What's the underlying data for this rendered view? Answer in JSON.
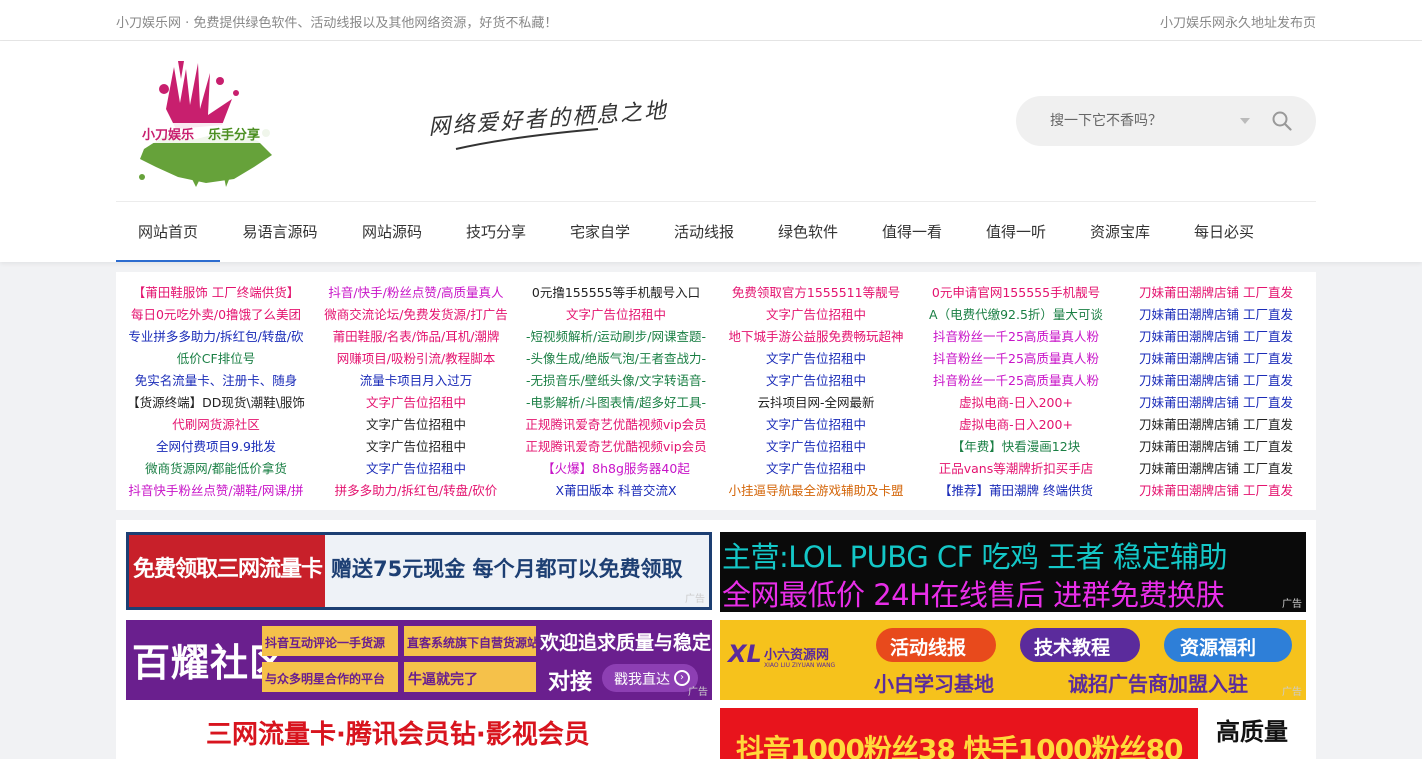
{
  "topbar": {
    "left_text": "小刀娱乐网 · 免费提供绿色软件、活动线报以及其他网络资源，好货不私藏！",
    "right_text": "小刀娱乐网永久地址发布页"
  },
  "logo": {
    "text_left": "小刀娱乐",
    "text_right": "乐手分享"
  },
  "slogan": "网络爱好者的栖息之地",
  "search": {
    "placeholder": "搜一下它不香吗？"
  },
  "nav": {
    "items": [
      {
        "label": "网站首页",
        "active": true
      },
      {
        "label": "易语言源码"
      },
      {
        "label": "网站源码"
      },
      {
        "label": "技巧分享"
      },
      {
        "label": "宅家自学"
      },
      {
        "label": "活动线报"
      },
      {
        "label": "绿色软件"
      },
      {
        "label": "值得一看"
      },
      {
        "label": "值得一听"
      },
      {
        "label": "资源宝库"
      },
      {
        "label": "每日必买"
      }
    ]
  },
  "text_ads": {
    "columns": [
      [
        {
          "text": "【莆田鞋服饰 工厂终端供货】",
          "color": "#e4136f"
        },
        {
          "text": "每日0元吃外卖/0撸饿了么美团",
          "color": "#e4136f"
        },
        {
          "text": "专业拼多多助力/拆红包/转盘/砍",
          "color": "#1a2bb8"
        },
        {
          "text": "低价CF排位号",
          "color": "#1a7f44"
        },
        {
          "text": "免实名流量卡、注册卡、随身",
          "color": "#1a2bb8"
        },
        {
          "text": "【货源终端】DD现货\\潮鞋\\服饰",
          "color": "#222222"
        },
        {
          "text": "代刷网货源社区",
          "color": "#e4136f"
        },
        {
          "text": "全网付费项目9.9批发",
          "color": "#1a2bb8"
        },
        {
          "text": "微商货源网/都能低价拿货",
          "color": "#1a7f44"
        },
        {
          "text": "抖音快手粉丝点赞/潮鞋/网课/拼",
          "color": "#c814c8"
        }
      ],
      [
        {
          "text": "抖音/快手/粉丝点赞/高质量真人",
          "color": "#c814c8"
        },
        {
          "text": "微商交流论坛/免费发货源/打广告",
          "color": "#e4136f"
        },
        {
          "text": "莆田鞋服/名表/饰品/耳机/潮牌",
          "color": "#e4136f"
        },
        {
          "text": "网赚项目/吸粉引流/教程脚本",
          "color": "#e4136f"
        },
        {
          "text": "流量卡项目月入过万",
          "color": "#1a2bb8"
        },
        {
          "text": "文字广告位招租中",
          "color": "#e4136f"
        },
        {
          "text": "文字广告位招租中",
          "color": "#222222"
        },
        {
          "text": "文字广告位招租中",
          "color": "#222222"
        },
        {
          "text": "文字广告位招租中",
          "color": "#1a2bb8"
        },
        {
          "text": "拼多多助力/拆红包/转盘/砍价",
          "color": "#e4136f"
        }
      ],
      [
        {
          "text": "0元撸155555等手机靓号入口",
          "color": "#222222"
        },
        {
          "text": "文字广告位招租中",
          "color": "#e4136f"
        },
        {
          "text": "-短视频解析/运动刷步/网课查题-",
          "color": "#1a7f44"
        },
        {
          "text": "-头像生成/绝版气泡/王者查战力-",
          "color": "#1a7f44"
        },
        {
          "text": "-无损音乐/壁纸头像/文字转语音-",
          "color": "#1a7f44"
        },
        {
          "text": "-电影解析/斗图表情/超多好工具-",
          "color": "#1a7f44"
        },
        {
          "text": "正规腾讯爱奇艺优酷视频vip会员",
          "color": "#e4136f"
        },
        {
          "text": "正规腾讯爱奇艺优酷视频vip会员",
          "color": "#e4136f"
        },
        {
          "text": "【火爆】8h8g服务器40起",
          "color": "#c814c8"
        },
        {
          "text": "X莆田版本 科普交流X",
          "color": "#1a2bb8"
        }
      ],
      [
        {
          "text": "免费领取官方1555511等靓号",
          "color": "#e4136f"
        },
        {
          "text": "文字广告位招租中",
          "color": "#e4136f"
        },
        {
          "text": "地下城手游公益服免费畅玩超神",
          "color": "#e4136f"
        },
        {
          "text": "文字广告位招租中",
          "color": "#1a2bb8"
        },
        {
          "text": "文字广告位招租中",
          "color": "#1a2bb8"
        },
        {
          "text": "云抖项目网-全网最新",
          "color": "#222222"
        },
        {
          "text": "文字广告位招租中",
          "color": "#1a2bb8"
        },
        {
          "text": "文字广告位招租中",
          "color": "#1a2bb8"
        },
        {
          "text": "文字广告位招租中",
          "color": "#1a2bb8"
        },
        {
          "text": "小挂逼导航最全游戏辅助及卡盟",
          "color": "#d4660a"
        }
      ],
      [
        {
          "text": "0元申请官网155555手机靓号",
          "color": "#e4136f"
        },
        {
          "text": "A（电费代缴92.5折）量大可谈",
          "color": "#1a7f44"
        },
        {
          "text": "抖音粉丝一千25高质量真人粉",
          "color": "#c814c8"
        },
        {
          "text": "抖音粉丝一千25高质量真人粉",
          "color": "#c814c8"
        },
        {
          "text": "抖音粉丝一千25高质量真人粉",
          "color": "#c814c8"
        },
        {
          "text": "虚拟电商-日入200+",
          "color": "#e4136f"
        },
        {
          "text": "虚拟电商-日入200+",
          "color": "#e4136f"
        },
        {
          "text": "【年费】快看漫画12块",
          "color": "#1a7f44"
        },
        {
          "text": "正品vans等潮牌折扣买手店",
          "color": "#e4136f"
        },
        {
          "text": "【推荐】莆田潮牌 终端供货",
          "color": "#1a2bb8"
        }
      ],
      [
        {
          "text": "刀妹莆田潮牌店铺 工厂直发",
          "color": "#e4136f"
        },
        {
          "text": "刀妹莆田潮牌店铺 工厂直发",
          "color": "#1a2bb8"
        },
        {
          "text": "刀妹莆田潮牌店铺 工厂直发",
          "color": "#1a2bb8"
        },
        {
          "text": "刀妹莆田潮牌店铺 工厂直发",
          "color": "#1a2bb8"
        },
        {
          "text": "刀妹莆田潮牌店铺 工厂直发",
          "color": "#1a2bb8"
        },
        {
          "text": "刀妹莆田潮牌店铺 工厂直发",
          "color": "#1a2bb8"
        },
        {
          "text": "刀妹莆田潮牌店铺 工厂直发",
          "color": "#222222"
        },
        {
          "text": "刀妹莆田潮牌店铺 工厂直发",
          "color": "#222222"
        },
        {
          "text": "刀妹莆田潮牌店铺 工厂直发",
          "color": "#222222"
        },
        {
          "text": "刀妹莆田潮牌店铺 工厂直发",
          "color": "#e4136f"
        }
      ]
    ]
  },
  "banners": {
    "ad_label": "广告",
    "b1": {
      "big": "免费领取三网流量卡",
      "small": "赠送75元现金 每个月都可以免费领取"
    },
    "b2": {
      "line1": "主营:LOL PUBG  CF 吃鸡 王者 稳定辅助",
      "line2": "全网最低价 24H在线售后 进群免费换肤"
    },
    "b3": {
      "brand": "百耀社区",
      "tag1": "抖音互动评论一手货源",
      "tag2": "直客系统旗下自营货源站",
      "tag3": "与众多明星合作的平台",
      "tag4": "牛逼就完了",
      "cta1": "欢迎追求质量与稳定",
      "cta2": "对接",
      "btn": "戳我直达"
    },
    "b4": {
      "brand": "小六资源网",
      "brand_sub": "XIAO LIU ZIYUAN WANG",
      "pill1": "活动线报",
      "pill2": "技术教程",
      "pill3": "资源福利",
      "line1": "小白学习基地",
      "line2": "诚招广告商加盟入驻"
    },
    "b5": {
      "line1": "三网流量卡·腾讯会员钻·影视会员"
    },
    "b6": {
      "line1": "抖音1000粉丝38  快手1000粉丝80",
      "side": "高质量"
    }
  }
}
